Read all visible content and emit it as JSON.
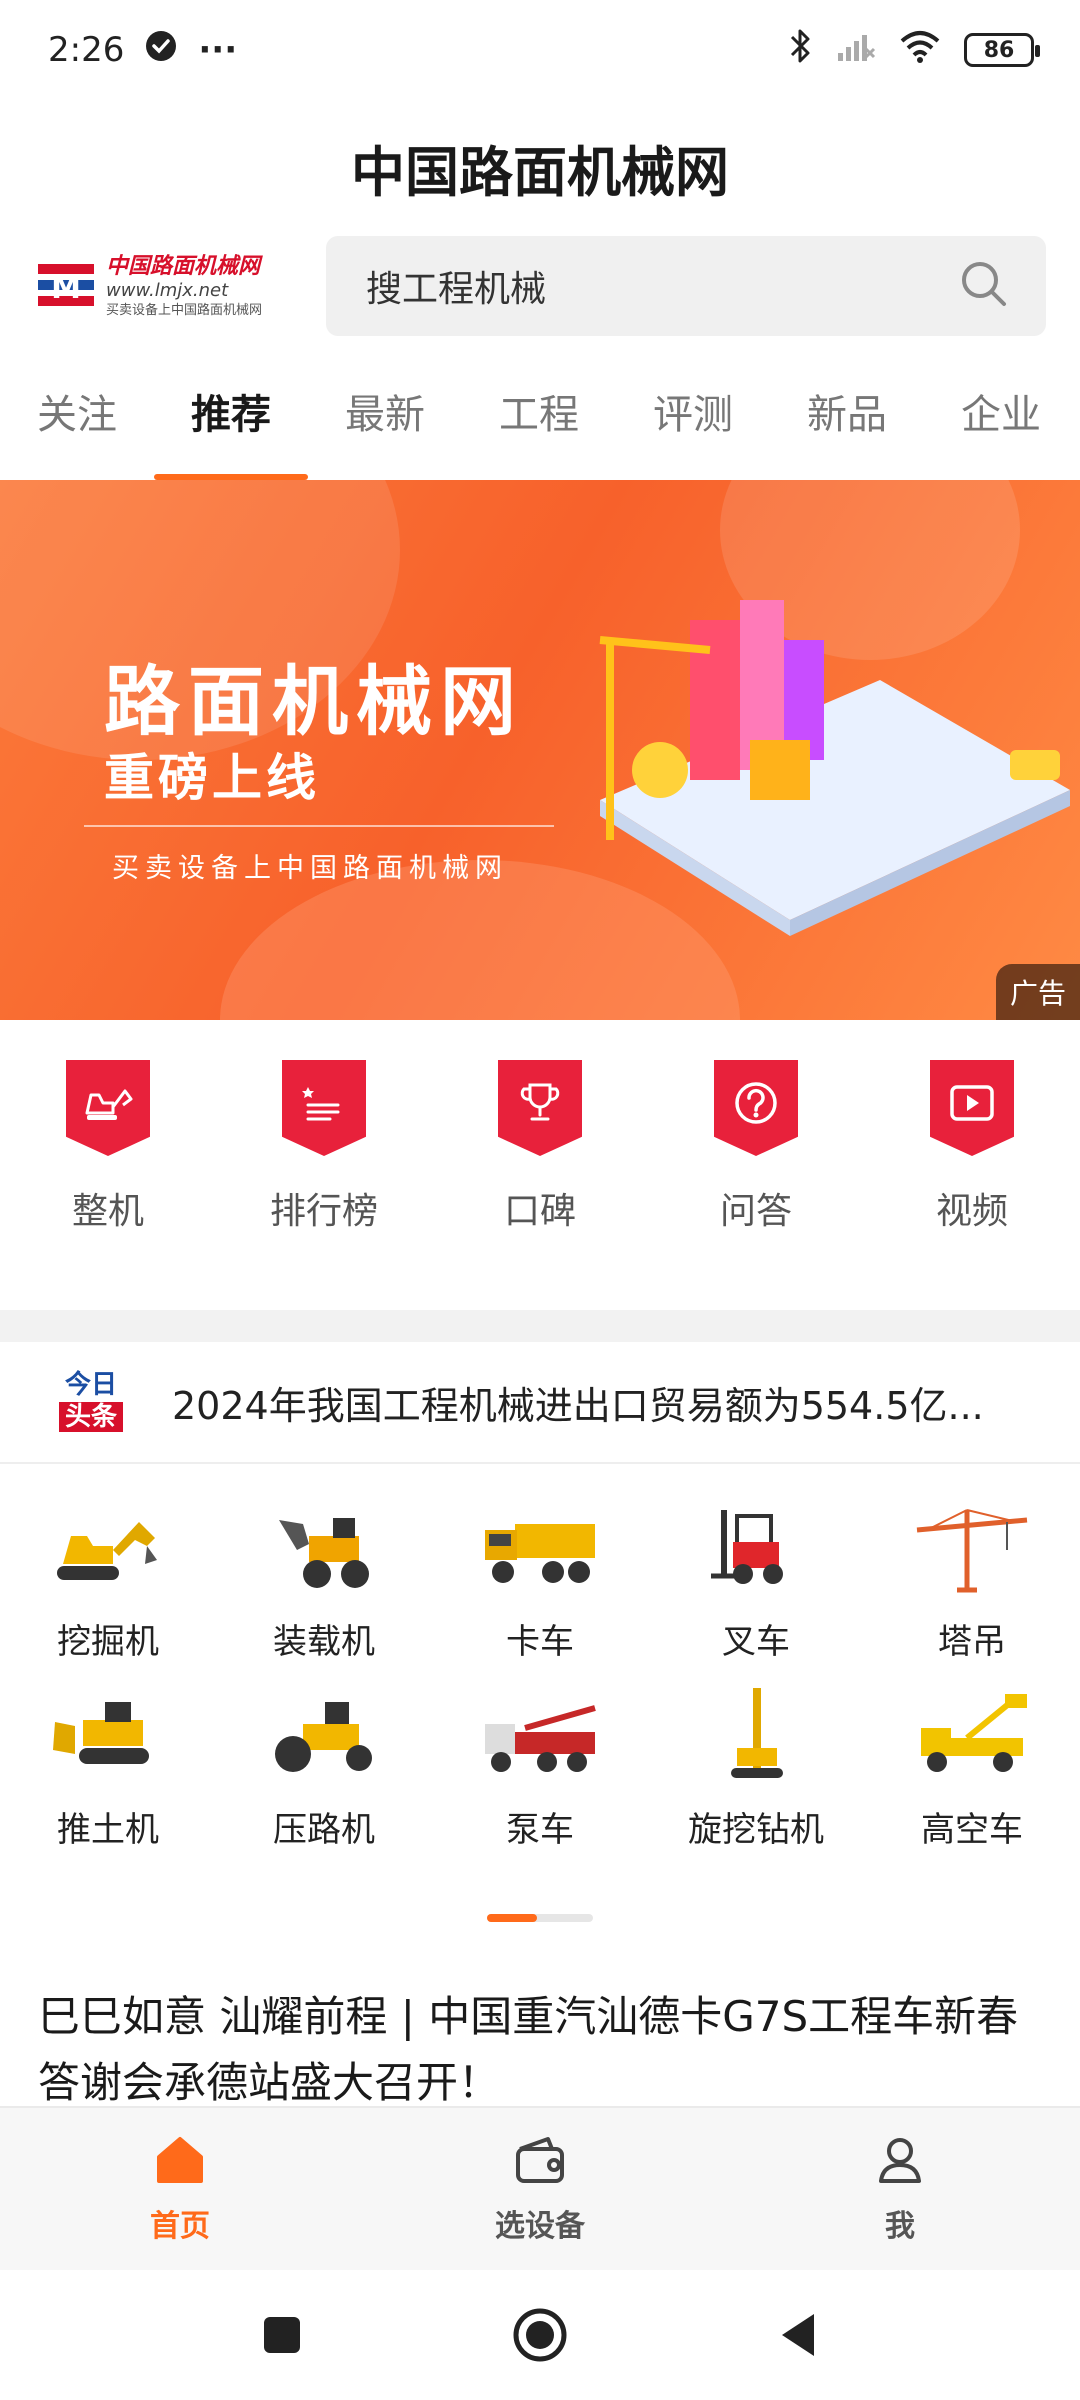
{
  "status_bar": {
    "time": "2:26",
    "more": "···",
    "battery": "86"
  },
  "app": {
    "title": "中国路面机械网"
  },
  "logo": {
    "cn": "中国路面机械网",
    "en": "www.lmjx.net",
    "sub": "买卖设备上中国路面机械网"
  },
  "search": {
    "placeholder": "搜工程机械"
  },
  "tabs": [
    {
      "label": "关注"
    },
    {
      "label": "推荐",
      "active": true
    },
    {
      "label": "最新"
    },
    {
      "label": "工程"
    },
    {
      "label": "评测"
    },
    {
      "label": "新品"
    },
    {
      "label": "企业"
    }
  ],
  "banner": {
    "headline": "路面机械网",
    "subheadline": "重磅上线",
    "tagline": "买卖设备上中国路面机械网",
    "ad_label": "广告"
  },
  "quick_menu": [
    {
      "label": "整机",
      "icon": "excavator-icon"
    },
    {
      "label": "排行榜",
      "icon": "ranking-list-icon"
    },
    {
      "label": "口碑",
      "icon": "trophy-icon"
    },
    {
      "label": "问答",
      "icon": "question-icon"
    },
    {
      "label": "视频",
      "icon": "video-play-icon"
    }
  ],
  "headline": {
    "source_top": "今日",
    "source_bottom": "头条",
    "text": "2024年我国工程机械进出口贸易额为554.5亿..."
  },
  "categories": [
    {
      "label": "挖掘机"
    },
    {
      "label": "装载机"
    },
    {
      "label": "卡车"
    },
    {
      "label": "叉车"
    },
    {
      "label": "塔吊"
    },
    {
      "label": "推土机"
    },
    {
      "label": "压路机"
    },
    {
      "label": "泵车"
    },
    {
      "label": "旋挖钻机"
    },
    {
      "label": "高空车"
    }
  ],
  "news": {
    "title": "巳巳如意 汕耀前程 | 中国重汽汕德卡G7S工程车新春答谢会承德站盛大召开！"
  },
  "bottom_nav": [
    {
      "label": "首页",
      "icon": "home-icon",
      "active": true
    },
    {
      "label": "选设备",
      "icon": "wallet-icon"
    },
    {
      "label": "我",
      "icon": "user-icon"
    }
  ],
  "colors": {
    "accent": "#ff6a1a",
    "brand_red": "#e8213b",
    "banner_orange": "#f7612b"
  }
}
